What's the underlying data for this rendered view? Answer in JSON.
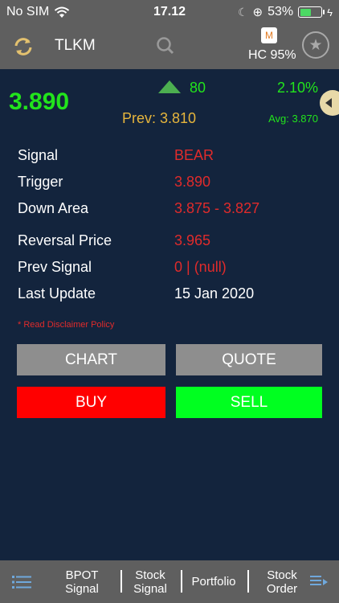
{
  "status": {
    "carrier": "No SIM",
    "time": "17.12",
    "battery": "53%",
    "battery_level": 0.53
  },
  "nav": {
    "title": "TLKM",
    "hc_badge": "M",
    "hc_text": "HC 95%"
  },
  "quote": {
    "price": "3.890",
    "change": "80",
    "change_pct": "2.10%",
    "prev": "Prev: 3.810",
    "avg": "Avg: 3.870"
  },
  "info": [
    {
      "label": "Signal",
      "value": "BEAR"
    },
    {
      "label": "Trigger",
      "value": "3.890"
    },
    {
      "label": "Down Area",
      "value": "3.875 - 3.827"
    },
    {
      "label": "Reversal Price",
      "value": "3.965"
    },
    {
      "label": "Prev Signal",
      "value": "0 | (null)"
    },
    {
      "label": "Last Update",
      "value": "15 Jan 2020"
    }
  ],
  "disclaimer": "* Read Disclaimer Policy",
  "buttons": {
    "chart": "CHART",
    "quote": "QUOTE",
    "buy": "BUY",
    "sell": "SELL"
  },
  "tabs": [
    {
      "label": "BPOT\nSignal"
    },
    {
      "label": "Stock\nSignal"
    },
    {
      "label": "Portfolio"
    },
    {
      "label": "Stock\nOrder"
    }
  ],
  "colors": {
    "background": "#13243d",
    "bar": "#5f5f5f",
    "up": "#22e41c",
    "down": "#e02b2b",
    "prev": "#e6b53c",
    "buy": "#ff0000",
    "sell": "#00ff20"
  },
  "icons": {
    "refresh": "refresh-icon",
    "search": "search-icon",
    "star": "star-icon",
    "menu": "list-icon",
    "order": "order-icon"
  }
}
